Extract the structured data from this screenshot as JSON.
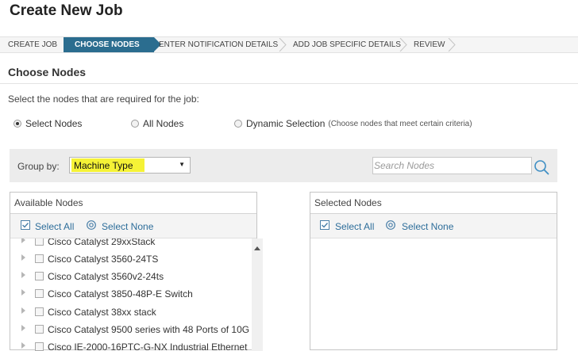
{
  "page": {
    "title": "Create New Job"
  },
  "wizard": {
    "steps": [
      {
        "label": "CREATE JOB",
        "active": false
      },
      {
        "label": "CHOOSE NODES",
        "active": true
      },
      {
        "label": "ENTER NOTIFICATION DETAILS",
        "active": false
      },
      {
        "label": "ADD JOB SPECIFIC DETAILS",
        "active": false
      },
      {
        "label": "REVIEW",
        "active": false
      }
    ]
  },
  "section": {
    "title": "Choose Nodes",
    "instruction": "Select the nodes that are required for the job:"
  },
  "selection_mode": {
    "options": [
      {
        "label": "Select Nodes",
        "selected": true
      },
      {
        "label": "All Nodes",
        "selected": false
      },
      {
        "label": "Dynamic Selection",
        "hint": "(Choose nodes that meet certain criteria)",
        "selected": false
      }
    ]
  },
  "group_by": {
    "label": "Group by:",
    "value": "Machine Type",
    "highlight_color": "#f5f236"
  },
  "search": {
    "placeholder": "Search Nodes",
    "value": ""
  },
  "available": {
    "title": "Available Nodes",
    "select_all": "Select All",
    "select_none": "Select None",
    "items": [
      "Cisco Catalyst 29xxStack",
      "Cisco Catalyst 3560-24TS",
      "Cisco Catalyst 3560v2-24ts",
      "Cisco Catalyst 3850-48P-E Switch",
      "Cisco Catalyst 38xx stack",
      "Cisco Catalyst 9500 series with 48 Ports of 10G",
      "Cisco IE-2000-16PTC-G-NX Industrial Ethernet"
    ]
  },
  "selected": {
    "title": "Selected Nodes",
    "select_all": "Select All",
    "select_none": "Select None"
  },
  "colors": {
    "accent": "#2b6d8f",
    "link": "#2d6d9a"
  }
}
